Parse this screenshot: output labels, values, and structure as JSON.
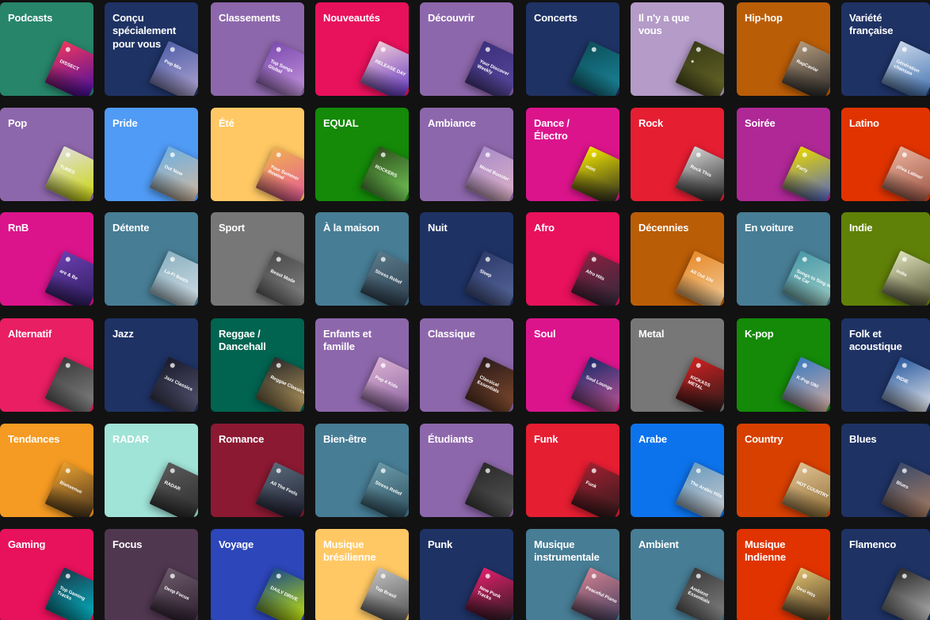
{
  "categories": [
    {
      "label": "Podcasts",
      "bg": "#27856a",
      "cover": "#f0365e",
      "cover2": "#3a0ca3",
      "cover_text": "DISSECT"
    },
    {
      "label": "Conçu\nspécialement\npour vous",
      "bg": "#1e3264",
      "cover": "#4f5fa8",
      "cover2": "#b7a8d4",
      "cover_text": "Pop Mix"
    },
    {
      "label": "Classements",
      "bg": "#8d67ab",
      "cover": "#7d4bb0",
      "cover2": "#c99ae0",
      "cover_text": "Top Songs Global"
    },
    {
      "label": "Nouveautés",
      "bg": "#e8115b",
      "cover": "#efc8d6",
      "cover2": "#5a2fc0",
      "cover_text": "RELEASE DAY"
    },
    {
      "label": "Découvrir",
      "bg": "#8d67ab",
      "cover": "#3c2f7a",
      "cover2": "#5a4aa0",
      "cover_text": "Your Discover Weekly"
    },
    {
      "label": "Concerts",
      "bg": "#1e3264",
      "cover": "#0d4f5a",
      "cover2": "#1c8ba0",
      "cover_text": ""
    },
    {
      "label": "Il n'y a que\nvous",
      "bg": "#b49bc8",
      "cover": "#383a15",
      "cover2": "#6a6b2a",
      "cover_text": "✦"
    },
    {
      "label": "Hip-hop",
      "bg": "#ba5d07",
      "cover": "#b39a7d",
      "cover2": "#222222",
      "cover_text": "RapCaviar"
    },
    {
      "label": "Variété\nfrançaise",
      "bg": "#1e3264",
      "cover": "#c7d6e8",
      "cover2": "#3d6fb0",
      "cover_text": "Génération chanson"
    },
    {
      "label": "Pop",
      "bg": "#8d67ab",
      "cover": "#e0e0d8",
      "cover2": "#c9d400",
      "cover_text": "TUBES"
    },
    {
      "label": "Pride",
      "bg": "#509bf5",
      "cover": "#6fb0e0",
      "cover2": "#d9b99b",
      "cover_text": "Out Now"
    },
    {
      "label": "Été",
      "bg": "#ffc864",
      "cover": "#f0b050",
      "cover2": "#e5559a",
      "cover_text": "Your Summer Rewind"
    },
    {
      "label": "EQUAL",
      "bg": "#148a08",
      "cover": "#2f4f1e",
      "cover2": "#7ad65c",
      "cover_text": "ROCKERS"
    },
    {
      "label": "Ambiance",
      "bg": "#8d67ab",
      "cover": "#a98cc8",
      "cover2": "#e3b6c9",
      "cover_text": "Mood Booster"
    },
    {
      "label": "Dance /\nÉlectro",
      "bg": "#dc148c",
      "cover": "#f2e600",
      "cover2": "#222222",
      "cover_text": "mint"
    },
    {
      "label": "Rock",
      "bg": "#e61e32",
      "cover": "#d2d2d2",
      "cover2": "#1a1a1a",
      "cover_text": "Rock This"
    },
    {
      "label": "Soirée",
      "bg": "#af2896",
      "cover": "#e8d800",
      "cover2": "#4a5fd0",
      "cover_text": "Party"
    },
    {
      "label": "Latino",
      "bg": "#e13300",
      "cover": "#e8b09a",
      "cover2": "#9a5040",
      "cover_text": "¡Viva Latino!"
    },
    {
      "label": "RnB",
      "bg": "#dc148c",
      "cover": "#6b3fb0",
      "cover2": "#2a1a5a",
      "cover_text": "are & Be"
    },
    {
      "label": "Détente",
      "bg": "#477d95",
      "cover": "#8ab0c0",
      "cover2": "#d7e2e8",
      "cover_text": "Lo-Fi Beats"
    },
    {
      "label": "Sport",
      "bg": "#777777",
      "cover": "#4a4a4a",
      "cover2": "#8a8a8a",
      "cover_text": "Beast Mode"
    },
    {
      "label": "À la maison",
      "bg": "#477d95",
      "cover": "#5a7a8a",
      "cover2": "#2a3a4a",
      "cover_text": "Stress Relief"
    },
    {
      "label": "Nuit",
      "bg": "#1e3264",
      "cover": "#2d3a6a",
      "cover2": "#5a6aa0",
      "cover_text": "Sleep"
    },
    {
      "label": "Afro",
      "bg": "#e8115b",
      "cover": "#8a2040",
      "cover2": "#2a2a3a",
      "cover_text": "Afro Hits"
    },
    {
      "label": "Décennies",
      "bg": "#ba5d07",
      "cover": "#e88a2a",
      "cover2": "#f0d0a0",
      "cover_text": "All Out 10s"
    },
    {
      "label": "En voiture",
      "bg": "#477d95",
      "cover": "#4a9aa8",
      "cover2": "#a0d0c8",
      "cover_text": "Songs to Sing in the Car"
    },
    {
      "label": "Indie",
      "bg": "#608108",
      "cover": "#dce0b8",
      "cover2": "#4a4a2a",
      "cover_text": "Indie"
    },
    {
      "label": "Alternatif",
      "bg": "#e91e63",
      "cover": "#3a3a3a",
      "cover2": "#8a8a8a",
      "cover_text": ""
    },
    {
      "label": "Jazz",
      "bg": "#1e3264",
      "cover": "#1a1a2a",
      "cover2": "#5a5a7a",
      "cover_text": "Jazz Classics"
    },
    {
      "label": "Reggae /\nDancehall",
      "bg": "#006450",
      "cover": "#2a2a2a",
      "cover2": "#c0a060",
      "cover_text": "Reggae Classics"
    },
    {
      "label": "Enfants et\nfamille",
      "bg": "#8d67ab",
      "cover": "#d8b0d0",
      "cover2": "#8a60a0",
      "cover_text": "Pop 4 Kids"
    },
    {
      "label": "Classique",
      "bg": "#8d67ab",
      "cover": "#2a1a1a",
      "cover2": "#8a5030",
      "cover_text": "Classical Essentials"
    },
    {
      "label": "Soul",
      "bg": "#dc148c",
      "cover": "#1a2a6a",
      "cover2": "#d05a9a",
      "cover_text": "Soul Lounge"
    },
    {
      "label": "Metal",
      "bg": "#777777",
      "cover": "#d02020",
      "cover2": "#1a1a1a",
      "cover_text": "KICKASS METAL"
    },
    {
      "label": "K-pop",
      "bg": "#148a08",
      "cover": "#3a7ac0",
      "cover2": "#e0b0a0",
      "cover_text": "K-Pop ON!"
    },
    {
      "label": "Folk et\nacoustique",
      "bg": "#1e3264",
      "cover": "#2a5aa0",
      "cover2": "#f0f0f0",
      "cover_text": "INDIE"
    },
    {
      "label": "Tendances",
      "bg": "#f59b23",
      "cover": "#e8a030",
      "cover2": "#3a2a1a",
      "cover_text": "Bienvenue"
    },
    {
      "label": "RADAR",
      "bg": "#a0e3d7",
      "cover": "#5a5a5a",
      "cover2": "#2a2a2a",
      "cover_text": "RADAR"
    },
    {
      "label": "Romance",
      "bg": "#8c1932",
      "cover": "#5a6a7a",
      "cover2": "#1a1a2a",
      "cover_text": "All The Feels"
    },
    {
      "label": "Bien-être",
      "bg": "#477d95",
      "cover": "#6a9aa8",
      "cover2": "#2a4a5a",
      "cover_text": "Stress Relief"
    },
    {
      "label": "Étudiants",
      "bg": "#8d67ab",
      "cover": "#2a2a2a",
      "cover2": "#5a5a5a",
      "cover_text": ""
    },
    {
      "label": "Funk",
      "bg": "#e61e32",
      "cover": "#a02030",
      "cover2": "#2a1a1a",
      "cover_text": "Funk"
    },
    {
      "label": "Arabe",
      "bg": "#0d73ec",
      "cover": "#6a9ac0",
      "cover2": "#d0d0d0",
      "cover_text": "The Arabic Hits"
    },
    {
      "label": "Country",
      "bg": "#d84000",
      "cover": "#e0c090",
      "cover2": "#8a6a30",
      "cover_text": "HOT COUNTRY"
    },
    {
      "label": "Blues",
      "bg": "#1e3264",
      "cover": "#3a4a6a",
      "cover2": "#b08060",
      "cover_text": "Blues"
    },
    {
      "label": "Gaming",
      "bg": "#e8115b",
      "cover": "#1a3a4a",
      "cover2": "#00c0d0",
      "cover_text": "Top Gaming Tracks"
    },
    {
      "label": "Focus",
      "bg": "#503750",
      "cover": "#6a5a6a",
      "cover2": "#2a1a2a",
      "cover_text": "Deep Focus"
    },
    {
      "label": "Voyage",
      "bg": "#2d46b9",
      "cover": "#1a4a8a",
      "cover2": "#d0f000",
      "cover_text": "DAILY DRIVE"
    },
    {
      "label": "Musique\nbrésilienne",
      "bg": "#ffc864",
      "cover": "#c0c0c0",
      "cover2": "#4a4a4a",
      "cover_text": "Top Brasil"
    },
    {
      "label": "Punk",
      "bg": "#1e3264",
      "cover": "#e0206a",
      "cover2": "#1a1a1a",
      "cover_text": "New Punk Tracks"
    },
    {
      "label": "Musique\ninstrumentale",
      "bg": "#477d95",
      "cover": "#d08090",
      "cover2": "#3a3a5a",
      "cover_text": "Peaceful Piano"
    },
    {
      "label": "Ambient",
      "bg": "#477d95",
      "cover": "#3a3a3a",
      "cover2": "#8a8a8a",
      "cover_text": "Ambient Essentials"
    },
    {
      "label": "Musique\nIndienne",
      "bg": "#e13300",
      "cover": "#e0c070",
      "cover2": "#3a2a1a",
      "cover_text": "Desi Hits"
    },
    {
      "label": "Flamenco",
      "bg": "#1e3264",
      "cover": "#2a2a2a",
      "cover2": "#c0c0c0",
      "cover_text": ""
    }
  ]
}
